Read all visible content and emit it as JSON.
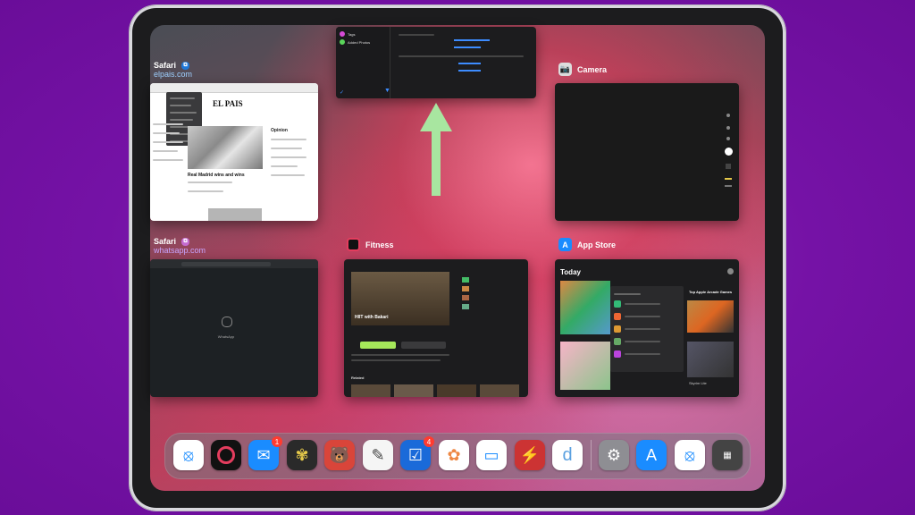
{
  "cards": {
    "safari_1": {
      "app": "Safari",
      "sub": "elpais.com",
      "headline": "EL PAIS",
      "opinion": "Opinion",
      "story": "Real Madrid wins and wins"
    },
    "safari_2": {
      "app": "Safari",
      "sub": "whatsapp.com",
      "center_label": "WhatsApp"
    },
    "fitness": {
      "app": "Fitness",
      "video_title": "HIIT with Bakari",
      "section": "Related"
    },
    "camera": {
      "app": "Camera"
    },
    "appstore": {
      "app": "App Store",
      "today": "Today",
      "title_right": "Top Apple Arcade Games",
      "sub_right": "Skyrim Lite"
    }
  },
  "top_card": {
    "left1": "Tags",
    "left2": "Added Photos"
  },
  "dock": {
    "mail_badge": "1",
    "tasks_badge": "4",
    "apps": [
      "Safari",
      "Fitness",
      "Mail",
      "Tes",
      "Bear",
      "Drafts",
      "Things",
      "Photos",
      "Files",
      "Instruments",
      "Day One",
      "Settings",
      "App Store",
      "Safari",
      "App Library"
    ]
  },
  "colors": {
    "accent": "#a8e6a0",
    "background": "#7512a6"
  }
}
